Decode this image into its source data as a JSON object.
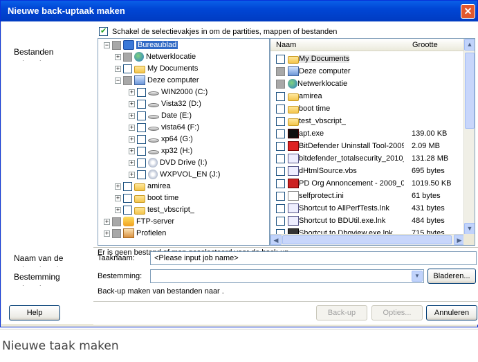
{
  "window": {
    "title": "Nieuwe back-uptaak maken",
    "close_glyph": "✕"
  },
  "sidebar": {
    "items": [
      {
        "label": "Bestanden"
      },
      {
        "label": "Naam van de"
      },
      {
        "label": "Bestemming"
      }
    ]
  },
  "top_checkbox": {
    "label": "Schakel de selectievakjes in om de partities, mappen of bestanden",
    "checked": true
  },
  "tree": [
    {
      "label": "Bureaublad",
      "icon": "desktop-icon",
      "selected": true
    },
    {
      "label": "Netwerklocatie",
      "icon": "network-icon"
    },
    {
      "label": "My Documents",
      "icon": "folder-icon"
    },
    {
      "label": "Deze computer",
      "icon": "computer-icon"
    },
    {
      "label": "WIN2000 (C:)",
      "icon": "drive-icon"
    },
    {
      "label": "Vista32 (D:)",
      "icon": "drive-icon"
    },
    {
      "label": "Date (E:)",
      "icon": "drive-icon"
    },
    {
      "label": "vista64 (F:)",
      "icon": "drive-icon"
    },
    {
      "label": "xp64 (G:)",
      "icon": "drive-icon"
    },
    {
      "label": "xp32 (H:)",
      "icon": "drive-icon"
    },
    {
      "label": "DVD Drive (I:)",
      "icon": "cd-icon"
    },
    {
      "label": "WXPVOL_EN (J:)",
      "icon": "cd-icon"
    },
    {
      "label": "amirea",
      "icon": "folder-icon"
    },
    {
      "label": "boot time",
      "icon": "folder-icon"
    },
    {
      "label": "test_vbscript_",
      "icon": "folder-icon"
    },
    {
      "label": "FTP-server",
      "icon": "ftp-icon"
    },
    {
      "label": "Profielen",
      "icon": "profile-icon"
    }
  ],
  "files": {
    "col_name": "Naam",
    "col_size": "Grootte",
    "rows": [
      {
        "name": "My Documents",
        "size": "",
        "icon": "folder-icon"
      },
      {
        "name": "Deze computer",
        "size": "",
        "icon": "computer-icon"
      },
      {
        "name": "Netwerklocatie",
        "size": "",
        "icon": "network-icon"
      },
      {
        "name": "amirea",
        "size": "",
        "icon": "folder-icon"
      },
      {
        "name": "boot time",
        "size": "",
        "icon": "folder-icon"
      },
      {
        "name": "test_vbscript_",
        "size": "",
        "icon": "folder-icon"
      },
      {
        "name": "apt.exe",
        "size": "139.00 KB",
        "icon": "exe-icon"
      },
      {
        "name": "BitDefender Uninstall Tool-20090...",
        "size": "2.09 MB",
        "icon": "bitdefender-icon"
      },
      {
        "name": "bitdefender_totalsecurity_2010_...",
        "size": "131.28 MB",
        "icon": "installer-icon"
      },
      {
        "name": "dHtmlSource.vbs",
        "size": "695 bytes",
        "icon": "script-icon"
      },
      {
        "name": "PD Org Annoncement - 2009_03...",
        "size": "1019.50 KB",
        "icon": "document-icon"
      },
      {
        "name": "selfprotect.ini",
        "size": "61 bytes",
        "icon": "ini-icon"
      },
      {
        "name": "Shortcut to AllPerfTests.lnk",
        "size": "431 bytes",
        "icon": "shortcut-icon"
      },
      {
        "name": "Shortcut to BDUtil.exe.lnk",
        "size": "484 bytes",
        "icon": "shortcut-icon"
      },
      {
        "name": "Shortcut to Dbgview.exe.lnk",
        "size": "715 bytes",
        "icon": "tool-icon"
      }
    ]
  },
  "status": "Er is geen bestand of map geselecteerd voor de back-up.",
  "job_name": {
    "label": "Taaknaam:",
    "value": "<Please input job name>"
  },
  "destination": {
    "label": "Bestemming:",
    "value": "",
    "browse_label": "Bladeren..."
  },
  "destination_hint": "Back-up maken van bestanden naar .",
  "buttons": {
    "help": "Help",
    "backup": "Back-up",
    "options": "Opties...",
    "cancel": "Annuleren"
  },
  "caption": "Nieuwe taak maken"
}
